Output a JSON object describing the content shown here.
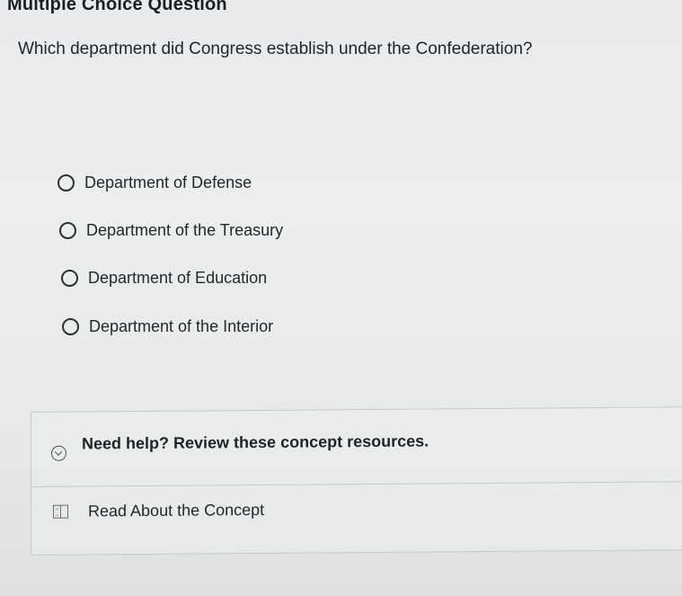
{
  "header": {
    "title": "Multiple Choice Question"
  },
  "question": {
    "text": "Which department did Congress establish under the Confederation?"
  },
  "options": [
    {
      "label": "Department of Defense",
      "selected": false
    },
    {
      "label": "Department of the Treasury",
      "selected": false
    },
    {
      "label": "Department of Education",
      "selected": false
    },
    {
      "label": "Department of the Interior",
      "selected": false
    }
  ],
  "help": {
    "title": "Need help? Review these concept resources.",
    "expand_icon": "chevron-down-icon",
    "resources": [
      {
        "icon": "book-icon",
        "label": "Read About the Concept"
      }
    ]
  }
}
